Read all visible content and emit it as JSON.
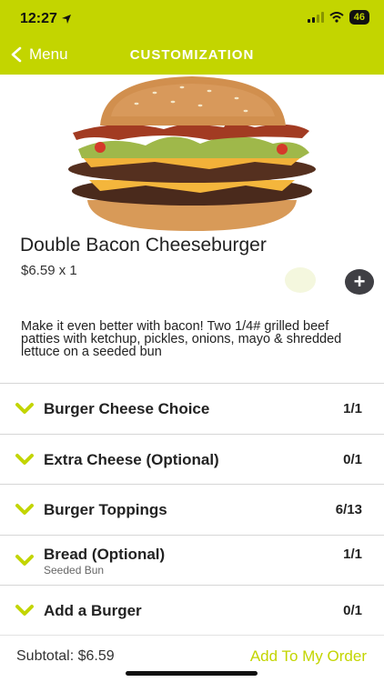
{
  "status_bar": {
    "time": "12:27",
    "battery": "46"
  },
  "nav": {
    "back_label": "Menu",
    "title": "Customization"
  },
  "product": {
    "name": "Double Bacon Cheeseburger",
    "price_qty": "$6.59 x 1",
    "description": "Make it even better with bacon! Two 1/4# grilled beef patties with ketchup, pickles, onions, mayo & shredded lettuce on a seeded bun",
    "add_icon": "+"
  },
  "options": [
    {
      "label": "Burger Cheese Choice",
      "count": "1/1"
    },
    {
      "label": "Extra Cheese (Optional)",
      "count": "0/1"
    },
    {
      "label": "Burger Toppings",
      "count": "6/13"
    },
    {
      "label": "Bread (Optional)",
      "sub": "Seeded Bun",
      "count": "1/1"
    },
    {
      "label": "Add a Burger",
      "count": "0/1"
    }
  ],
  "footer": {
    "subtotal": "Subtotal: $6.59",
    "add_to_order": "Add To My Order"
  },
  "colors": {
    "accent": "#c3d500",
    "dark_button": "#3f3f44"
  },
  "icons": {
    "back": "chevron-left-icon",
    "expand": "chevron-down-icon",
    "add": "plus-icon",
    "location": "location-arrow-icon",
    "signal": "signal-icon",
    "wifi": "wifi-icon",
    "battery": "battery-icon"
  }
}
